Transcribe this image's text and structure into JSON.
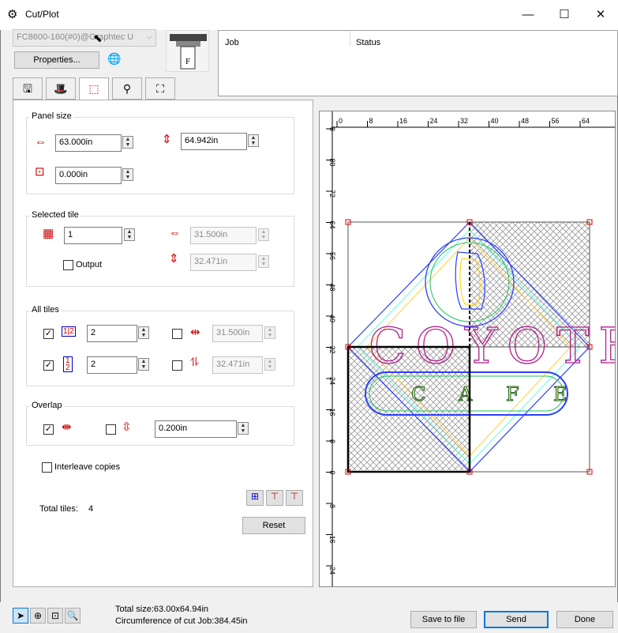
{
  "window": {
    "title": "Cut/Plot",
    "title_icon": "cutter-icon",
    "minimize": "—",
    "maximize": "☐",
    "close": "✕"
  },
  "device": {
    "combo_value": "FC8600-160(#0)@Graphtec U",
    "properties_label": "Properties..."
  },
  "job_table": {
    "col_job": "Job",
    "col_status": "Status"
  },
  "tabs": [
    {
      "name": "tab-plot",
      "icon": "🖫"
    },
    {
      "name": "tab-media",
      "icon": "🎩"
    },
    {
      "name": "tab-tiling",
      "icon": "⬚"
    },
    {
      "name": "tab-tool",
      "icon": "⚲"
    },
    {
      "name": "tab-marks",
      "icon": "⛶"
    }
  ],
  "panel_size": {
    "label": "Panel size",
    "width": "63.000in",
    "height": "64.942in",
    "margin": "0.000in"
  },
  "selected_tile": {
    "label": "Selected tile",
    "index": "1",
    "width": "31.500in",
    "height": "32.471in",
    "output_label": "Output"
  },
  "all_tiles": {
    "label": "All tiles",
    "cols": "2",
    "rows": "2",
    "width": "31.500in",
    "height": "32.471in"
  },
  "overlap": {
    "label": "Overlap",
    "value": "0.200in"
  },
  "interleave_label": "Interleave copies",
  "total_tiles_label": "Total tiles:",
  "total_tiles_value": "4",
  "reset_label": "Reset",
  "ruler": {
    "top": [
      "0",
      "8",
      "16",
      "24",
      "32",
      "40",
      "48",
      "56",
      "64"
    ],
    "left": [
      "8",
      "80",
      "72",
      "64",
      "56",
      "48",
      "40",
      "32",
      "24",
      "16",
      "8",
      "0",
      "-8",
      "-16",
      "-24"
    ]
  },
  "artwork": {
    "line1": "COYOTE",
    "line2_letters": [
      "C",
      "A",
      "F",
      "E"
    ]
  },
  "status": {
    "total_size": "Total size:63.00x64.94in",
    "circumference": "Circumference of cut Job:384.45in"
  },
  "footer": {
    "save_label": "Save to file",
    "send_label": "Send",
    "done_label": "Done"
  },
  "colors": {
    "accent": "#0078d7",
    "marker": "#e00000",
    "tile_hatch": "#9a9a9a"
  }
}
